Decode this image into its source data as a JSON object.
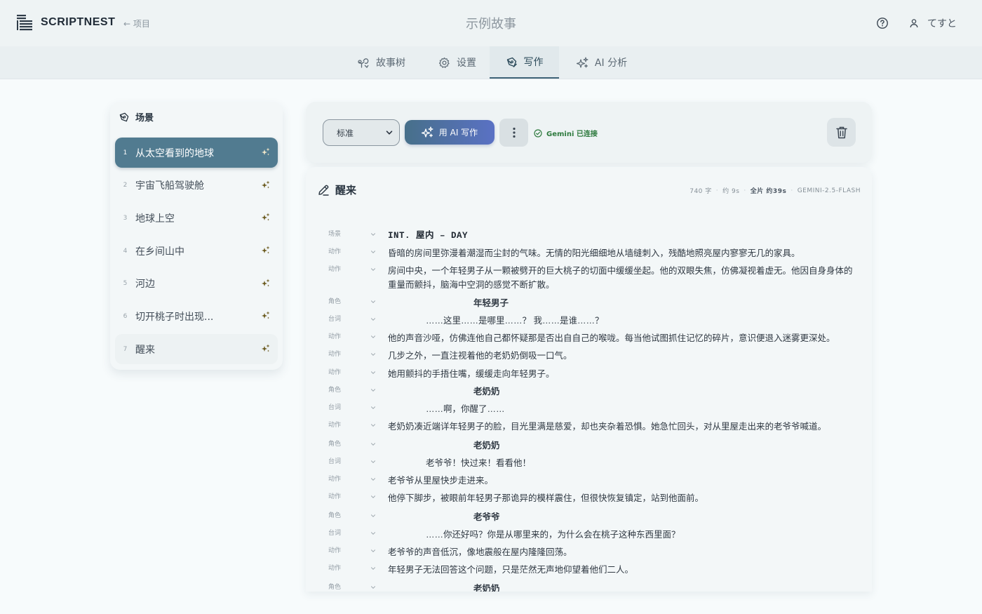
{
  "app": {
    "name": "SCRIPTNEST",
    "back_label": "← 项目",
    "story_title": "示例故事"
  },
  "user": {
    "name": "てすと"
  },
  "tabs": [
    {
      "label": "故事树",
      "icon": "tree-icon"
    },
    {
      "label": "设置",
      "icon": "gear-icon"
    },
    {
      "label": "写作",
      "icon": "pen-icon",
      "active": true
    },
    {
      "label": "AI 分析",
      "icon": "sparkle-icon"
    }
  ],
  "sidebar": {
    "title": "场景",
    "scenes": [
      {
        "num": "1",
        "label": "从太空看到的地球",
        "state": "active"
      },
      {
        "num": "2",
        "label": "宇宙飞船驾驶舱",
        "state": ""
      },
      {
        "num": "3",
        "label": "地球上空",
        "state": ""
      },
      {
        "num": "4",
        "label": "在乡间山中",
        "state": ""
      },
      {
        "num": "5",
        "label": "河边",
        "state": ""
      },
      {
        "num": "6",
        "label": "切开桃子时出现...",
        "state": ""
      },
      {
        "num": "7",
        "label": "醒来",
        "state": "current"
      }
    ]
  },
  "toolbar": {
    "mode_selected": "标准",
    "ai_write_label": "用 AI 写作",
    "status_text": "Gemini 已连接"
  },
  "editor": {
    "title": "醒来",
    "meta": {
      "chars": "740 字",
      "duration": "约 9s",
      "total": "全片 约39s",
      "model": "GEMINI-2.5-FLASH"
    },
    "lines": [
      {
        "type": "场景",
        "kind": "scene-h",
        "text": "INT. 屋内 – DAY"
      },
      {
        "type": "动作",
        "kind": "action",
        "text": "昏暗的房间里弥漫着潮湿而尘封的气味。无情的阳光细细地从墙缝刺入，残酷地照亮屋内寥寥无几的家具。"
      },
      {
        "type": "动作",
        "kind": "action",
        "text": "房间中央，一个年轻男子从一颗被劈开的巨大桃子的切面中缓缓坐起。他的双眼失焦，仿佛凝视着虚无。他因自身身体的重量而颤抖，脑海中空洞的感觉不断扩散。"
      },
      {
        "type": "角色",
        "kind": "char",
        "text": "年轻男子"
      },
      {
        "type": "台词",
        "kind": "dial",
        "text": "……这里……是哪里……？ 我……是谁……？"
      },
      {
        "type": "动作",
        "kind": "action",
        "text": "他的声音沙哑，仿佛连他自己都怀疑那是否出自自己的喉咙。每当他试图抓住记忆的碎片，意识便退入迷雾更深处。"
      },
      {
        "type": "动作",
        "kind": "action",
        "text": "几步之外，一直注视着他的老奶奶倒吸一口气。"
      },
      {
        "type": "动作",
        "kind": "action",
        "text": "她用颤抖的手捂住嘴，缓缓走向年轻男子。"
      },
      {
        "type": "角色",
        "kind": "char",
        "text": "老奶奶"
      },
      {
        "type": "台词",
        "kind": "dial",
        "text": "……啊，你醒了……"
      },
      {
        "type": "动作",
        "kind": "action",
        "text": "老奶奶凑近端详年轻男子的脸，目光里满是慈爱，却也夹杂着恐惧。她急忙回头，对从里屋走出来的老爷爷喊道。"
      },
      {
        "type": "角色",
        "kind": "char",
        "text": "老奶奶"
      },
      {
        "type": "台词",
        "kind": "dial",
        "text": "老爷爷！快过来！看看他！"
      },
      {
        "type": "动作",
        "kind": "action",
        "text": "老爷爷从里屋快步走进来。"
      },
      {
        "type": "动作",
        "kind": "action",
        "text": "他停下脚步，被眼前年轻男子那诡异的模样震住，但很快恢复镇定，站到他面前。"
      },
      {
        "type": "角色",
        "kind": "char",
        "text": "老爷爷"
      },
      {
        "type": "台词",
        "kind": "dial",
        "text": "……你还好吗？你是从哪里来的，为什么会在桃子这种东西里面？"
      },
      {
        "type": "动作",
        "kind": "action",
        "text": "老爷爷的声音低沉，像地震般在屋内隆隆回荡。"
      },
      {
        "type": "动作",
        "kind": "action",
        "text": "年轻男子无法回答这个问题，只是茫然无声地仰望着他们二人。"
      },
      {
        "type": "角色",
        "kind": "char",
        "text": "老奶奶"
      }
    ]
  },
  "colors": {
    "accent": "#517b90",
    "ai_gradient_start": "#47708a",
    "ai_gradient_end": "#5a71c4",
    "status_green": "#2e7a3e",
    "spark": "#6b5a1e"
  }
}
